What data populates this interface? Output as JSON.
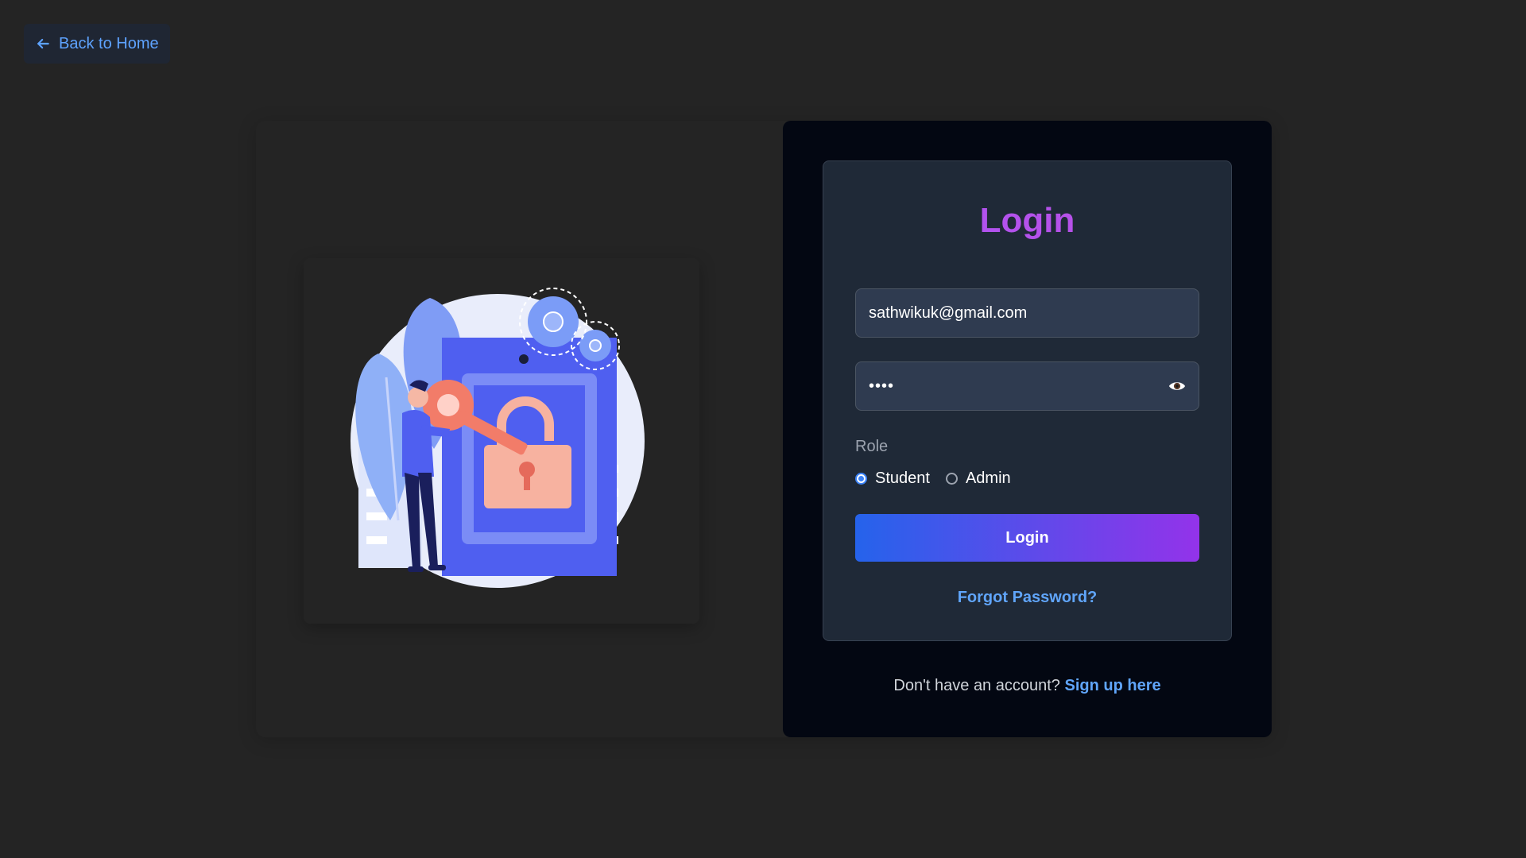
{
  "back_button": {
    "label": "Back to Home",
    "icon": "arrow-left-icon"
  },
  "login_form": {
    "title": "Login",
    "email_value": "sathwikuk@gmail.com",
    "password_masked": "••••",
    "password_toggle_icon": "eye-icon",
    "role_label": "Role",
    "roles": [
      {
        "label": "Student",
        "selected": true
      },
      {
        "label": "Admin",
        "selected": false
      }
    ],
    "submit_label": "Login",
    "forgot_password": "Forgot Password?",
    "signup_prompt": "Don't have an account?",
    "signup_link": "Sign up here"
  },
  "illustration": {
    "name": "login-security-illustration"
  },
  "colors": {
    "background": "#242424",
    "panel": "#030712",
    "card": "#1f2937",
    "accent_blue": "#60a5fa",
    "title_purple": "#a855f7",
    "button_gradient_start": "#2563eb",
    "button_gradient_end": "#9333ea"
  }
}
